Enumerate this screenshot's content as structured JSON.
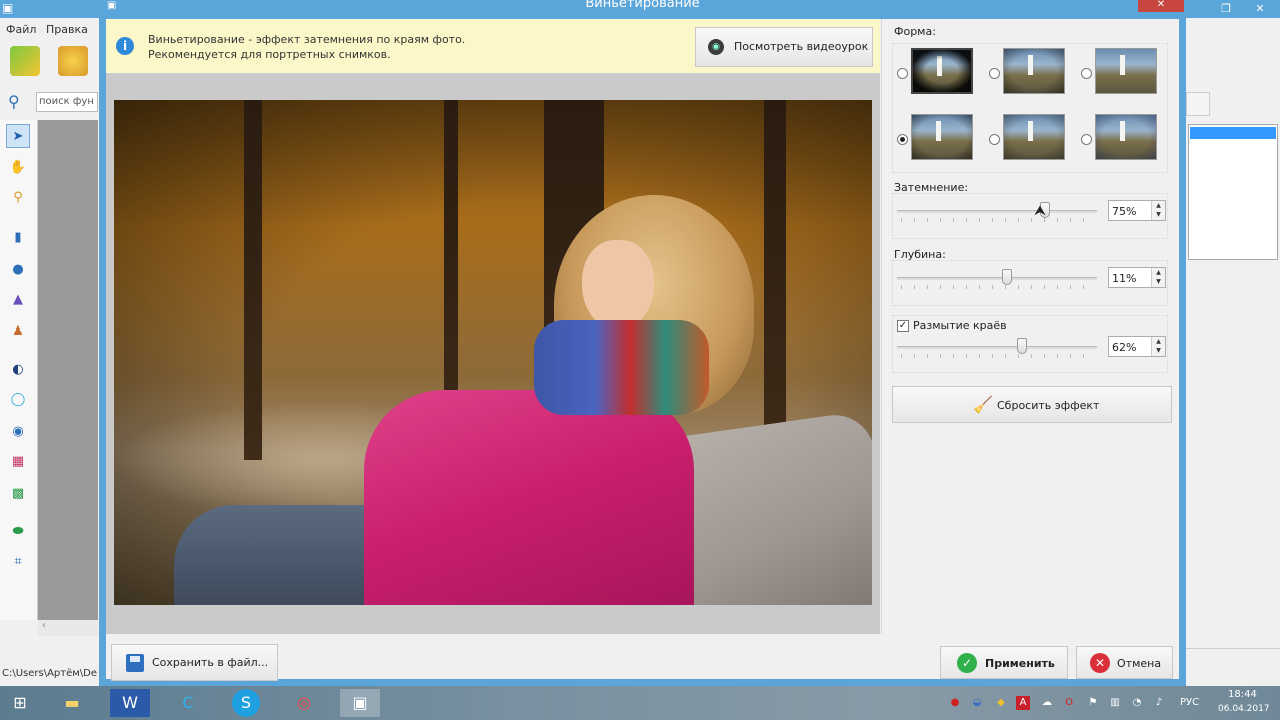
{
  "bg_app": {
    "menu": [
      "Файл",
      "Правка"
    ],
    "search_placeholder": "поиск фун",
    "status_path": "C:\\Users\\Артём\\De"
  },
  "dialog": {
    "title": "Виньетирование",
    "info_line1": "Виньетирование - эффект затемнения по краям фото.",
    "info_line2": "Рекомендуется для портретных снимков.",
    "video_button": "Посмотреть видеоурок",
    "save_button": "Сохранить в файл...",
    "apply_button": "Применить",
    "cancel_button": "Отмена"
  },
  "panel": {
    "shape_label": "Форма:",
    "shapes": [
      {
        "selected": false,
        "style": "dark-oval"
      },
      {
        "selected": false,
        "style": "soft-corner"
      },
      {
        "selected": false,
        "style": "light-corner"
      },
      {
        "selected": true,
        "style": "rounded-corner"
      },
      {
        "selected": false,
        "style": "medium-corner"
      },
      {
        "selected": false,
        "style": "blue-corner"
      }
    ],
    "darkening_label": "Затемнение:",
    "darkening_value": "75%",
    "darkening_level": 0.75,
    "depth_label": "Глубина:",
    "depth_value": "11%",
    "depth_level": 0.55,
    "blur_label": "Размытие краёв",
    "blur_checked": true,
    "blur_value": "62%",
    "blur_level": 0.63,
    "reset_button": "Сбросить эффект"
  },
  "taskbar": {
    "lang": "РУС",
    "time": "18:44",
    "date": "06.04.2017"
  }
}
